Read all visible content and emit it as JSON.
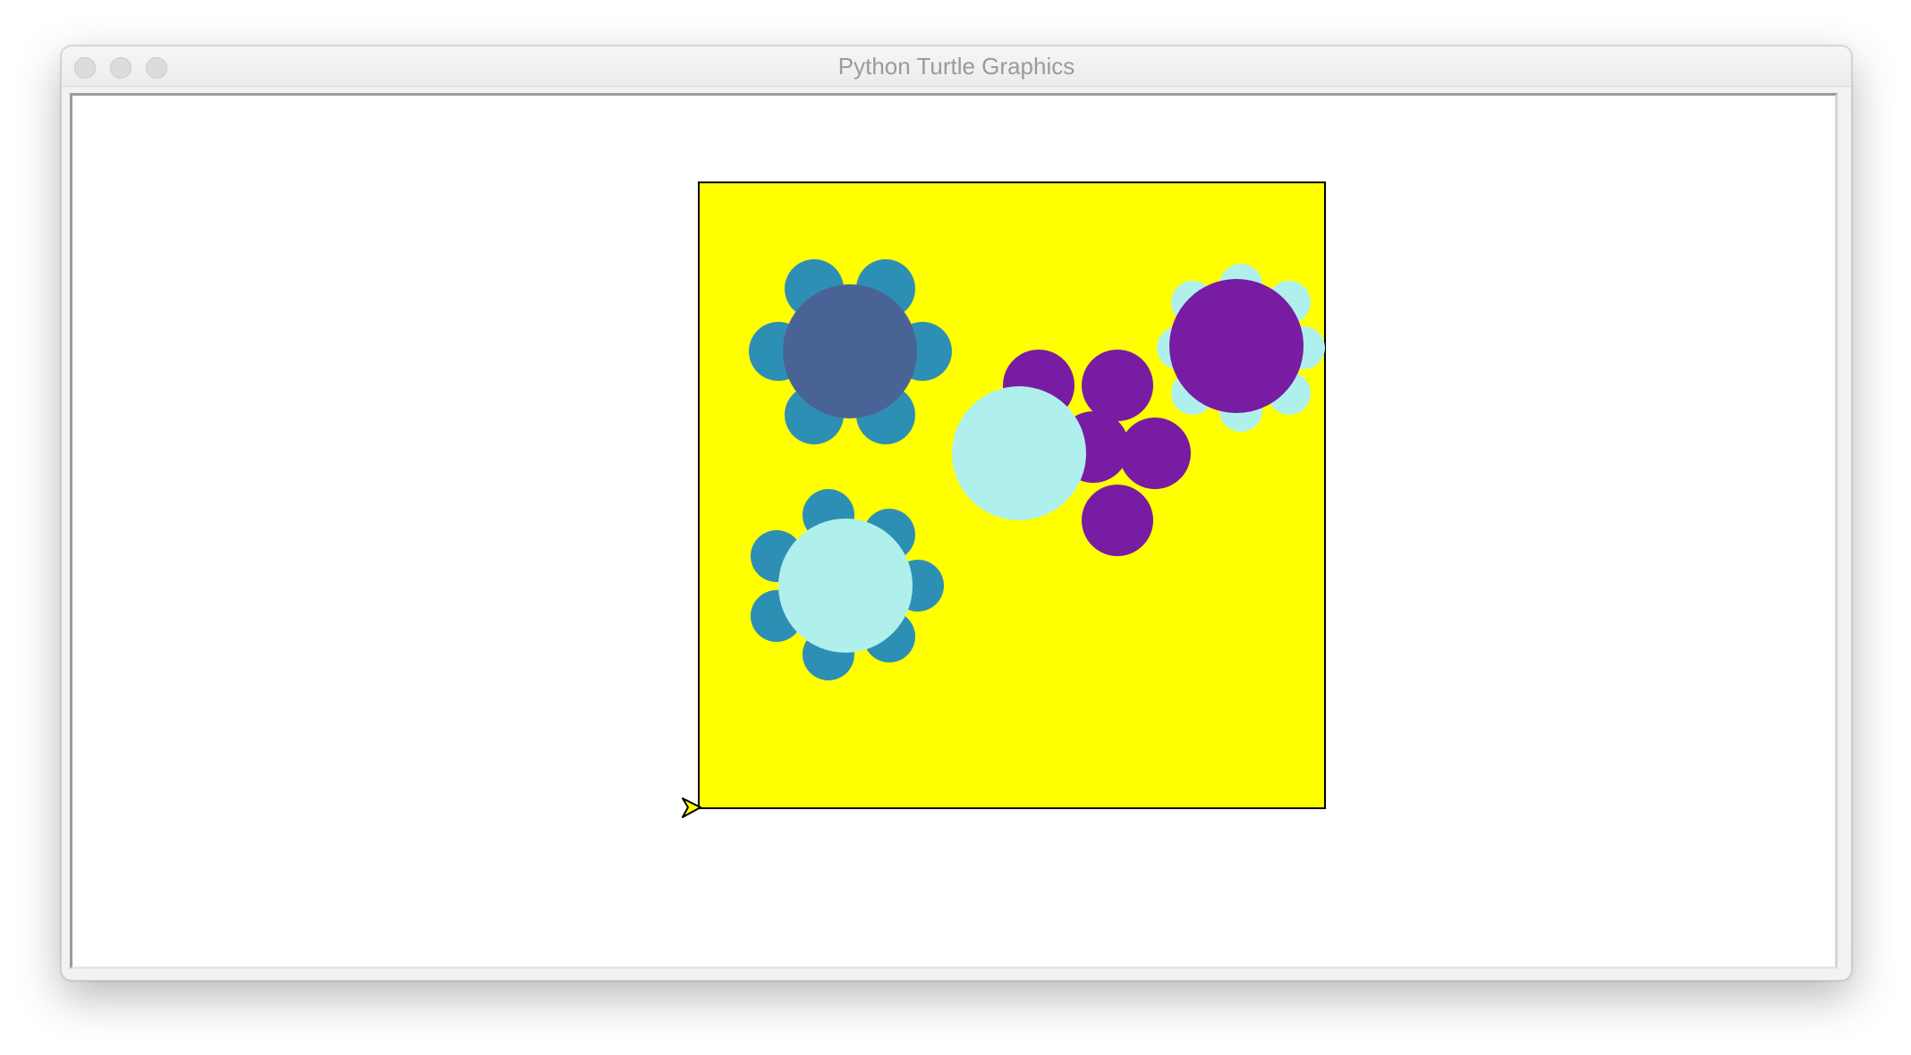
{
  "window": {
    "title": "Python Turtle Graphics"
  },
  "colors": {
    "background_square": "#ffff00",
    "teal_petal": "#2e8fb5",
    "slate_center": "#4a6396",
    "purple": "#781ca3",
    "aqua": "#b0f0ec",
    "turtle_fill": "#ffff00",
    "turtle_outline": "#000000"
  },
  "icons": {
    "turtle": "arrow-cursor-icon"
  }
}
